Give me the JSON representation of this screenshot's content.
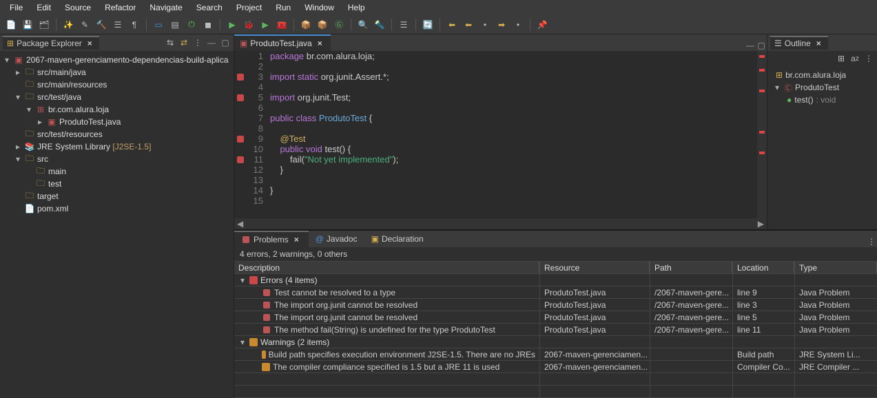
{
  "menu": [
    "File",
    "Edit",
    "Source",
    "Refactor",
    "Navigate",
    "Search",
    "Project",
    "Run",
    "Window",
    "Help"
  ],
  "packageExplorer": {
    "title": "Package Explorer",
    "project": "2067-maven-gerenciamento-dependencias-build-aplica",
    "nodes": {
      "srcMainJava": "src/main/java",
      "srcMainRes": "src/main/resources",
      "srcTestJava": "src/test/java",
      "pkgBr": "br.com.alura.loja",
      "file": "ProdutoTest.java",
      "srcTestRes": "src/test/resources",
      "jre": "JRE System Library",
      "jreVer": "[J2SE-1.5]",
      "src": "src",
      "main": "main",
      "test": "test",
      "target": "target",
      "pom": "pom.xml"
    }
  },
  "editor": {
    "tab": "ProdutoTest.java",
    "lines": [
      "1",
      "2",
      "3",
      "4",
      "5",
      "6",
      "7",
      "8",
      "9",
      "10",
      "11",
      "12",
      "13",
      "14",
      "15"
    ],
    "code": {
      "l1a": "package ",
      "l1b": "br.com.alura.loja;",
      "l3a": "import ",
      "l3b": "static ",
      "l3c": "org.junit.Assert.*;",
      "l5a": "import ",
      "l5b": "org.junit.Test;",
      "l7a": "public ",
      "l7b": "class ",
      "l7c": "ProdutoTest",
      " l7d": " {",
      "l9": "    @Test",
      "l10a": "    public ",
      "l10b": "void ",
      "l10c": "test() {",
      "l11a": "        fail(",
      "l11b": "\"Not yet implemented\"",
      "l11c": ");",
      "l12": "    }",
      "l14": "}"
    }
  },
  "outline": {
    "title": "Outline",
    "pkg": "br.com.alura.loja",
    "class": "ProdutoTest",
    "method": "test()",
    "ret": ": void"
  },
  "problems": {
    "tabs": {
      "problems": "Problems",
      "javadoc": "Javadoc",
      "decl": "Declaration"
    },
    "status": "4 errors, 2 warnings, 0 others",
    "cols": {
      "desc": "Description",
      "res": "Resource",
      "path": "Path",
      "loc": "Location",
      "type": "Type"
    },
    "errGroup": "Errors (4 items)",
    "warnGroup": "Warnings (2 items)",
    "rows": [
      {
        "d": "Test cannot be resolved to a type",
        "r": "ProdutoTest.java",
        "p": "/2067-maven-gere...",
        "l": "line 9",
        "t": "Java Problem"
      },
      {
        "d": "The import org.junit cannot be resolved",
        "r": "ProdutoTest.java",
        "p": "/2067-maven-gere...",
        "l": "line 3",
        "t": "Java Problem"
      },
      {
        "d": "The import org.junit cannot be resolved",
        "r": "ProdutoTest.java",
        "p": "/2067-maven-gere...",
        "l": "line 5",
        "t": "Java Problem"
      },
      {
        "d": "The method fail(String) is undefined for the type ProdutoTest",
        "r": "ProdutoTest.java",
        "p": "/2067-maven-gere...",
        "l": "line 11",
        "t": "Java Problem"
      }
    ],
    "wrows": [
      {
        "d": "Build path specifies execution environment J2SE-1.5. There are no JREs",
        "r": "2067-maven-gerenciamen...",
        "p": "",
        "l": "Build path",
        "t": "JRE System Li..."
      },
      {
        "d": "The compiler compliance specified is 1.5 but a JRE 11 is used",
        "r": "2067-maven-gerenciamen...",
        "p": "",
        "l": "Compiler Co...",
        "t": "JRE Compiler ..."
      }
    ]
  }
}
